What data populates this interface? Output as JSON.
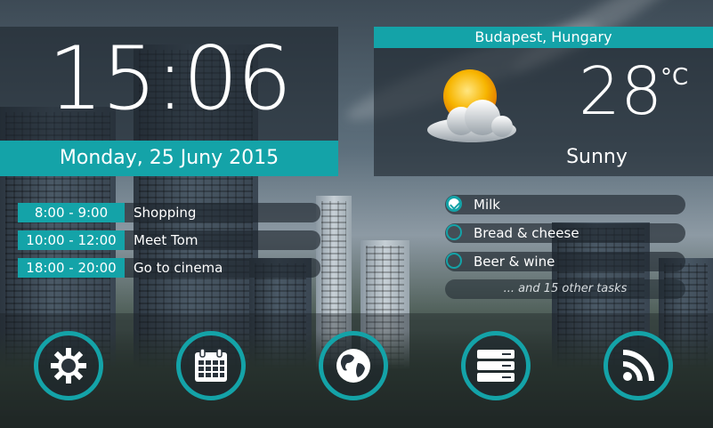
{
  "clock": {
    "time": "15:06",
    "date": "Monday, 25 Juny 2015"
  },
  "weather": {
    "city": "Budapest, Hungary",
    "temperature": "28",
    "unit": "°C",
    "condition": "Sunny",
    "icon": "sun-cloud-icon"
  },
  "agenda": [
    {
      "time": "8:00 - 9:00",
      "title": "Shopping"
    },
    {
      "time": "10:00 - 12:00",
      "title": "Meet Tom"
    },
    {
      "time": "18:00 - 20:00",
      "title": "Go to cinema"
    }
  ],
  "tasks": [
    {
      "label": "Milk",
      "done": true
    },
    {
      "label": "Bread & cheese",
      "done": false
    },
    {
      "label": "Beer & wine",
      "done": false
    }
  ],
  "tasks_more": "... and 15 other tasks",
  "dock": [
    {
      "icon": "settings-gear-icon"
    },
    {
      "icon": "calendar-icon"
    },
    {
      "icon": "globe-icon"
    },
    {
      "icon": "server-list-icon"
    },
    {
      "icon": "rss-feed-icon"
    }
  ],
  "colors": {
    "accent": "#14a3a8",
    "panel": "#1e262e"
  }
}
